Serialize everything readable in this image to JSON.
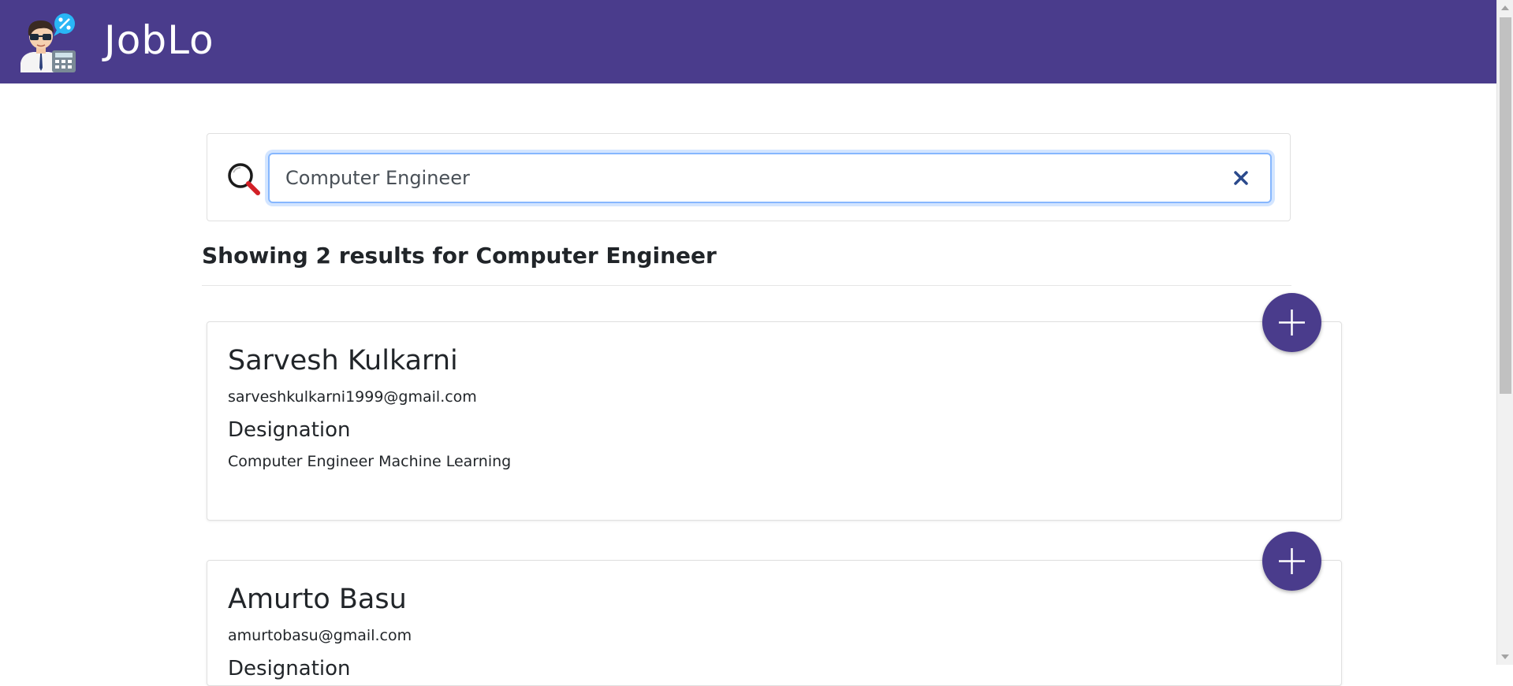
{
  "header": {
    "brand": "JobLo",
    "background": "#4a3c8c"
  },
  "search": {
    "value": "Computer Engineer",
    "icon": "magnifier-icon",
    "clear_icon": "close-icon"
  },
  "results": {
    "heading": "Showing 2 results for Computer Engineer",
    "items": [
      {
        "name": "Sarvesh Kulkarni",
        "email": "sarveshkulkarni1999@gmail.com",
        "designation_label": "Designation",
        "designation": "Computer Engineer Machine Learning"
      },
      {
        "name": "Amurto Basu",
        "email": "amurtobasu@gmail.com",
        "designation_label": "Designation",
        "designation": ""
      }
    ]
  },
  "add_button_icon": "plus-icon"
}
